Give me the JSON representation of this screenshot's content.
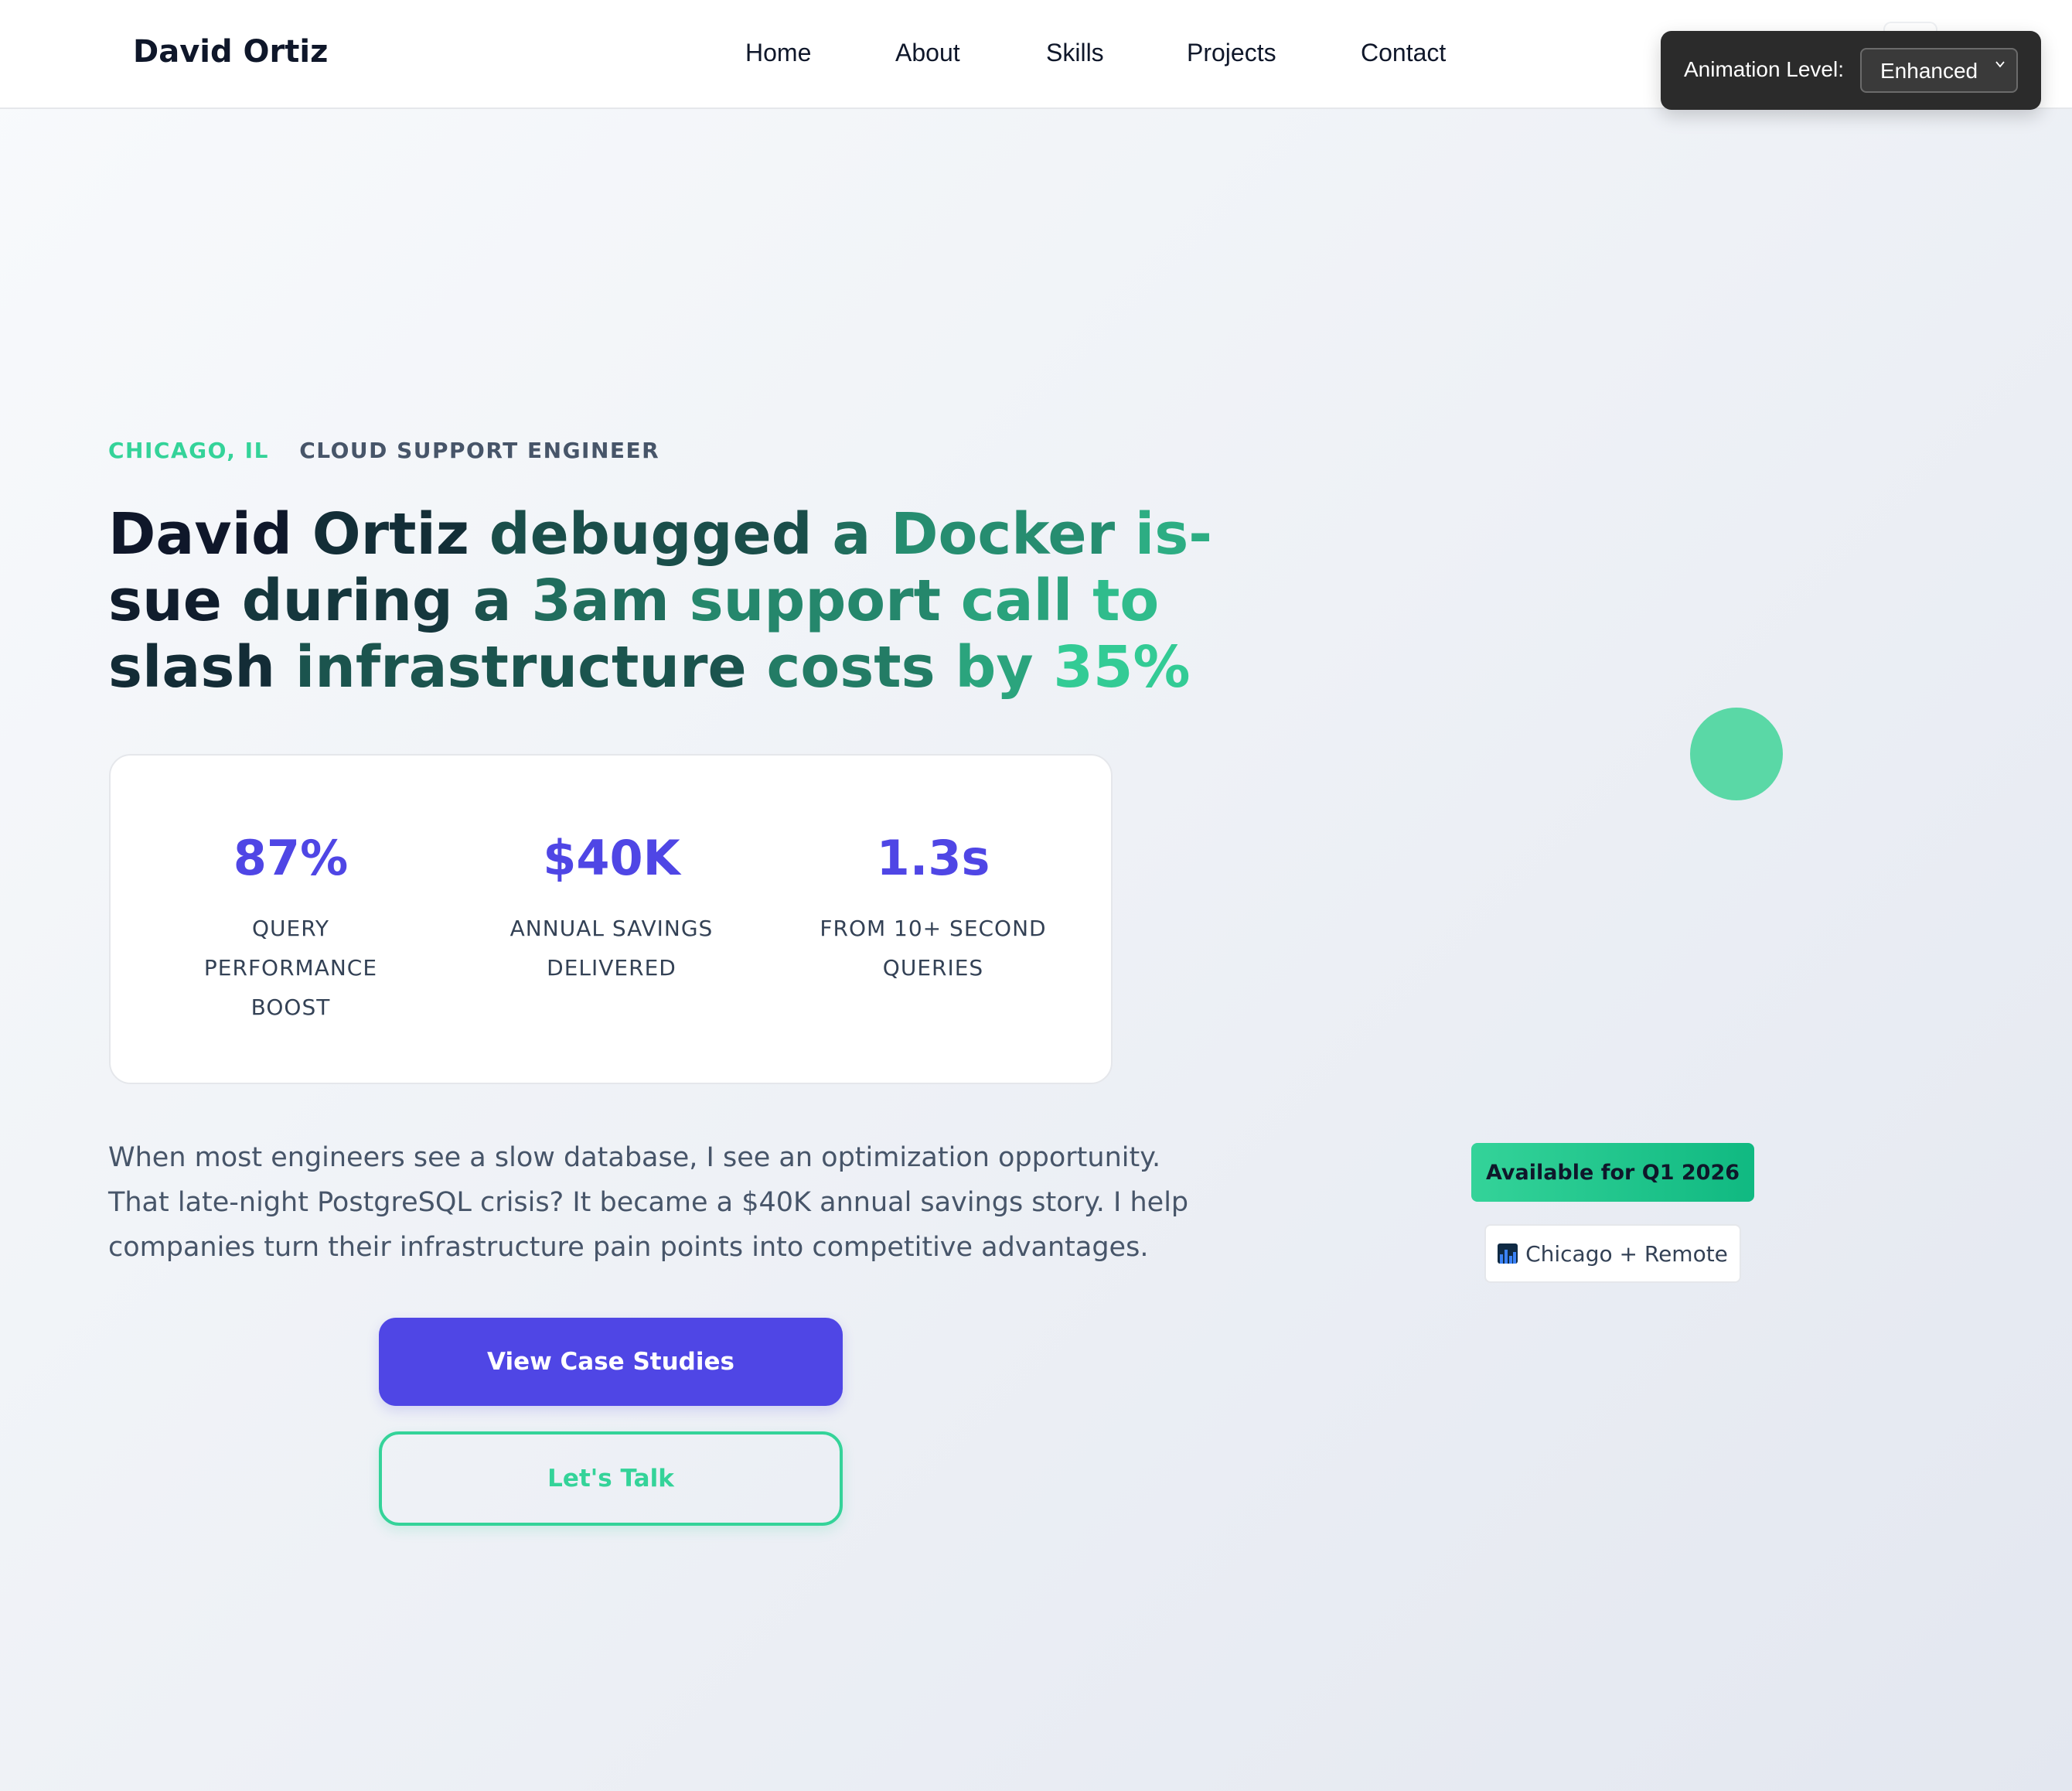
{
  "nav": {
    "brand": "David Ortiz",
    "links": [
      "Home",
      "About",
      "Skills",
      "Projects",
      "Contact"
    ]
  },
  "animation_control": {
    "label": "Animation Level:",
    "selected": "Enhanced"
  },
  "hero": {
    "location": "CHICAGO, IL",
    "role": "CLOUD SUPPORT ENGINEER",
    "headline_lines": [
      "David Ortiz debugged a Docker is-",
      "sue during a 3am support call to",
      "slash infrastructure costs by 35%"
    ],
    "stats": [
      {
        "value": "87%",
        "label_lines": [
          "QUERY",
          "PERFORMANCE",
          "BOOST"
        ]
      },
      {
        "value": "$40K",
        "label_lines": [
          "ANNUAL SAVINGS",
          "DELIVERED"
        ]
      },
      {
        "value": "1.3s",
        "label_lines": [
          "FROM 10+ SECOND",
          "QUERIES"
        ]
      }
    ],
    "description_lines": [
      "When most engineers see a slow database, I see an optimization opportunity.",
      "That late-night PostgreSQL crisis? It became a $40K annual savings story. I help",
      "companies turn their infrastructure pain points into competitive advantages."
    ],
    "primary_cta": "View Case Studies",
    "secondary_cta": "Let's Talk"
  },
  "sidebar": {
    "availability": "Available for Q1 2026",
    "location_badge": "Chicago + Remote",
    "location_icon": "city-night-icon"
  },
  "colors": {
    "accent_purple": "#4f46e5",
    "accent_green": "#34d399",
    "dark_text": "#0f172a",
    "headline_gradient": [
      "#0f172a",
      "#34d399"
    ]
  }
}
